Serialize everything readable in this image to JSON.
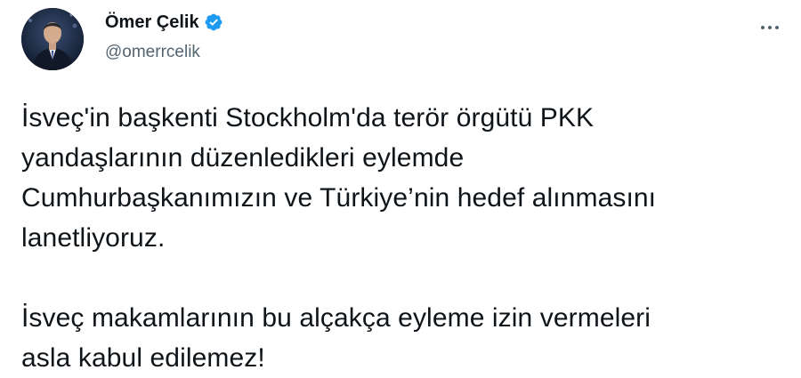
{
  "author": {
    "display_name": "Ömer Çelik",
    "handle": "@omerrcelik",
    "verified": true,
    "verified_color": "#1d9bf0"
  },
  "icons": {
    "verified": "verified-badge-icon",
    "more": "more-options-icon",
    "avatar": "profile-photo"
  },
  "tweet": {
    "paragraphs": [
      "İsveç'in başkenti Stockholm'da terör örgütü PKK\nyandaşlarının düzenledikleri eylemde\nCumhurbaşkanımızın ve Türkiye’nin hedef alınmasını\nlanetliyoruz.",
      "İsveç makamlarının bu alçakça eyleme izin vermeleri\nasla kabul edilemez!"
    ]
  },
  "colors": {
    "text_primary": "#0f1419",
    "text_secondary": "#536471",
    "background": "#ffffff"
  }
}
